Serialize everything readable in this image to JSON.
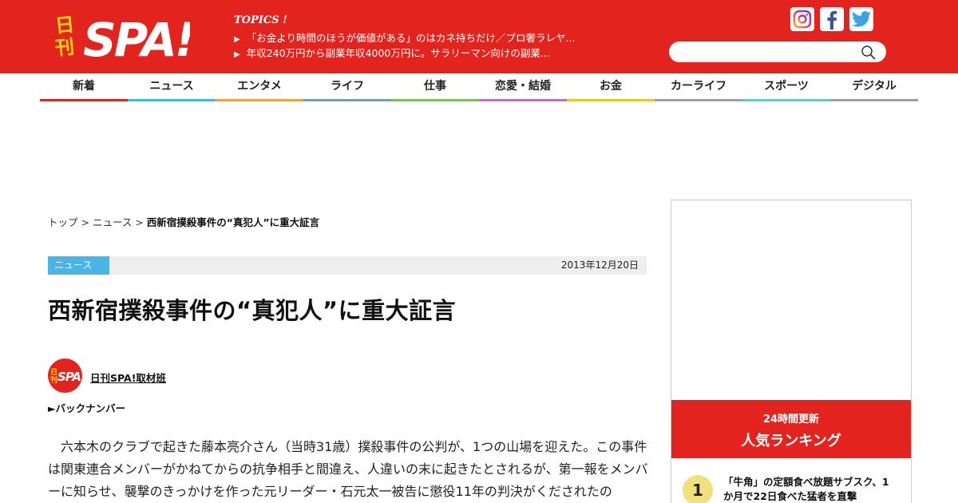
{
  "header": {
    "logo_kanji": "日刊",
    "logo_text": "SPA!",
    "topics_label": "TOPICS !",
    "topics": [
      "「お金より時間のほうが価値がある」のはカネ持ちだけ／プロ奢ラレヤ...",
      "年収240万円から副業年収4000万円に。サラリーマン向けの副業..."
    ],
    "search": {
      "placeholder": ""
    },
    "social": [
      "instagram-icon",
      "facebook-icon",
      "twitter-icon"
    ]
  },
  "nav": {
    "items": [
      {
        "label": "新着",
        "color": "#c9302c"
      },
      {
        "label": "ニュース",
        "color": "#4ab4e6"
      },
      {
        "label": "エンタメ",
        "color": "#f0a040"
      },
      {
        "label": "ライフ",
        "color": "#7a9ab8"
      },
      {
        "label": "仕事",
        "color": "#7fbf5a"
      },
      {
        "label": "恋愛・結婚",
        "color": "#b07ac0"
      },
      {
        "label": "お金",
        "color": "#e8c830"
      },
      {
        "label": "カーライフ",
        "color": "#a0a0a0"
      },
      {
        "label": "スポーツ",
        "color": "#6cc6c6"
      },
      {
        "label": "デジタル",
        "color": "#a0a0a0"
      }
    ]
  },
  "breadcrumb": {
    "home": "トップ",
    "sep": " > ",
    "category": "ニュース",
    "current": "西新宿撲殺事件の“真犯人”に重大証言"
  },
  "article": {
    "category": "ニュース",
    "date": "2013年12月20日",
    "title": "西新宿撲殺事件の“真犯人”に重大証言",
    "author": "日刊SPA!取材班",
    "backnumber": "►バックナンバー",
    "body": "六本木のクラブで起きた藤本亮介さん（当時31歳）撲殺事件の公判が、1つの山場を迎えた。この事件は関東連合メンバーがかねてからの抗争相手と間違え、人違いの末に起きたとされるが、第一報をメンバーに知らせ、襲撃のきっかけを作った元リーダー・石元太一被告に懲役11年の判決がくだされたの"
  },
  "sidebar": {
    "rank_sub": "24時間更新",
    "rank_title": "人気ランキング",
    "items": [
      {
        "rank": "1",
        "text": "「牛角」の定額食べ放題サブスク、1か月で22日食べた猛者を直撃"
      }
    ]
  },
  "colors": {
    "brand": "#e3231e",
    "category": "#4ab4e6"
  }
}
